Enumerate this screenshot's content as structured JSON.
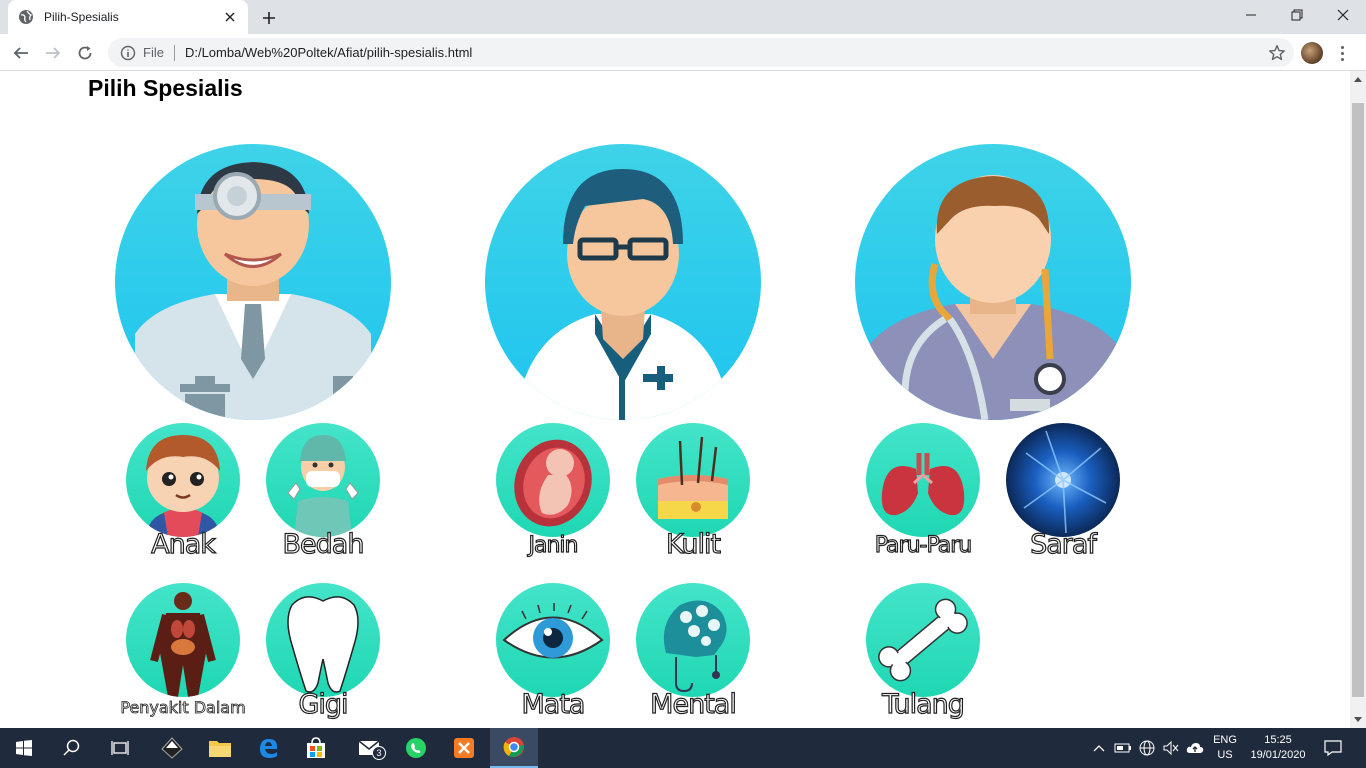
{
  "browser": {
    "tab_title": "Pilih-Spesialis",
    "scheme_label": "File",
    "url": "D:/Lomba/Web%20Poltek/Afiat/pilih-spesialis.html"
  },
  "page": {
    "title": "Pilih Spesialis"
  },
  "specialists": {
    "anak": "Anak",
    "bedah": "Bedah",
    "janin": "Janin",
    "kulit": "Kulit",
    "paru": "Paru-Paru",
    "saraf": "Saraf",
    "penyakit_dalam": "Penyakit Dalam",
    "gigi": "Gigi",
    "mata": "Mata",
    "mental": "Mental",
    "tulang": "Tulang"
  },
  "taskbar": {
    "mail_badge": "3",
    "lang_line1": "ENG",
    "lang_line2": "US",
    "time": "15:25",
    "date": "19/01/2020"
  },
  "colors": {
    "big_circle": "#2fd2ea",
    "small_circle": "#2fdcbd",
    "taskbar": "#1f2a3c"
  }
}
